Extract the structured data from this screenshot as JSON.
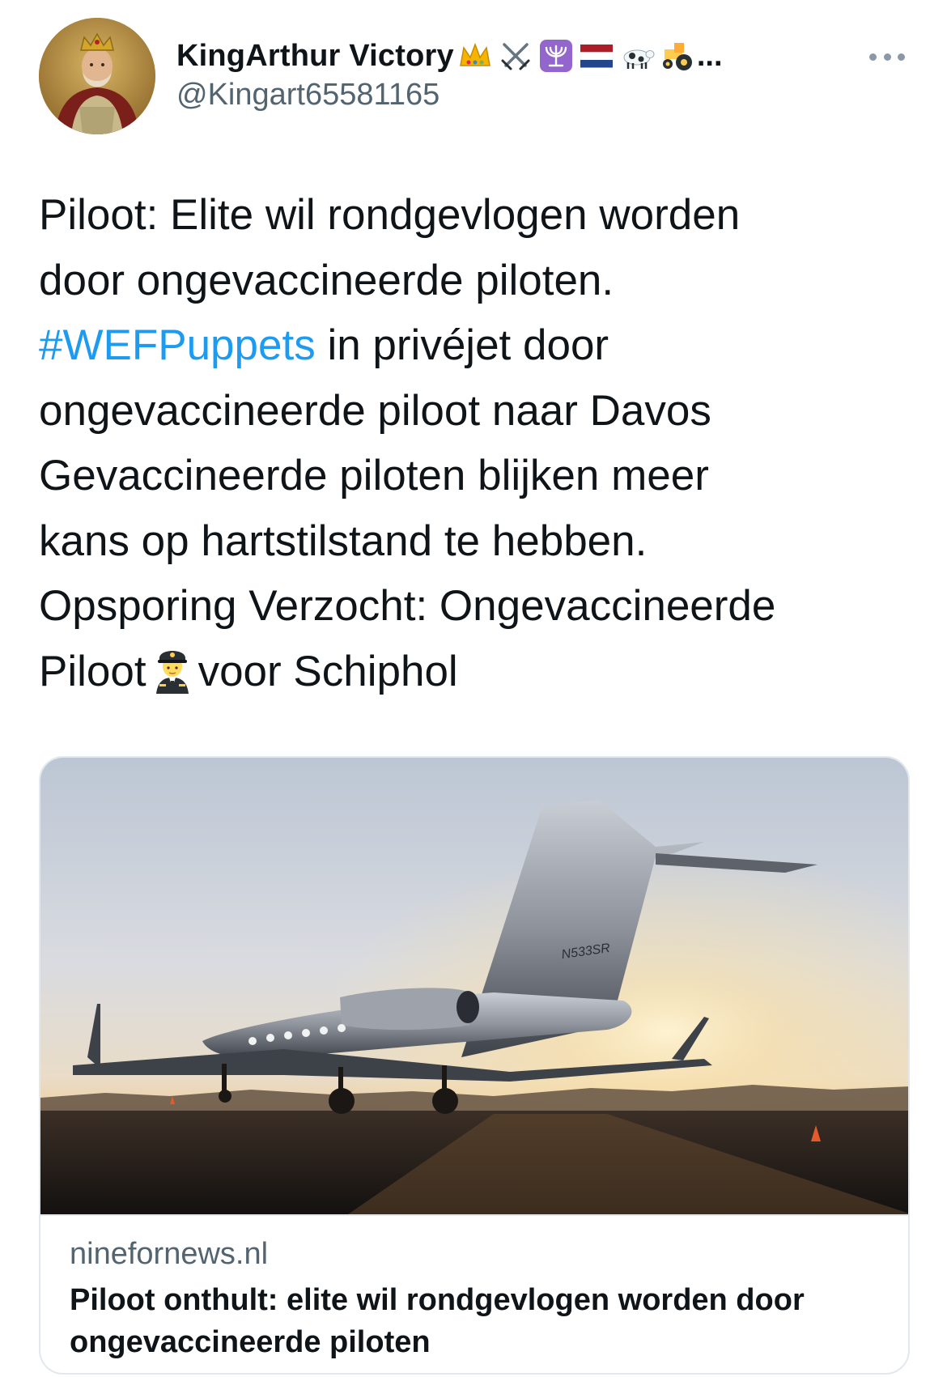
{
  "author": {
    "display_name": "KingArthur Victory",
    "handle": "@Kingart65581165",
    "name_emojis": [
      "crown-icon",
      "crossed-swords-icon",
      "menorah-icon",
      "netherlands-flag-icon",
      "cow-icon",
      "tractor-icon"
    ],
    "name_truncation": "..."
  },
  "tweet": {
    "lines": [
      "Piloot: Elite wil rondgevlogen worden",
      "door ongevaccineerde piloten.",
      "in privéjet door",
      "ongevaccineerde piloot naar Davos",
      "Gevaccineerde piloten blijken meer",
      "kans op hartstilstand te hebben.",
      "Opsporing Verzocht: Ongevaccineerde",
      "Piloot",
      "voor Schiphol"
    ],
    "hashtag": "#WEFPuppets",
    "hashtag_color": "#1d9bf0",
    "inline_emoji": "pilot-icon"
  },
  "link_card": {
    "image_tail_number": "N533SR",
    "domain": "ninefornews.nl",
    "title": "Piloot onthult: elite wil rondgevlogen worden door ongevaccineerde piloten"
  },
  "colors": {
    "text": "#0f1419",
    "secondary": "#536471",
    "border": "#e3e8ec"
  }
}
